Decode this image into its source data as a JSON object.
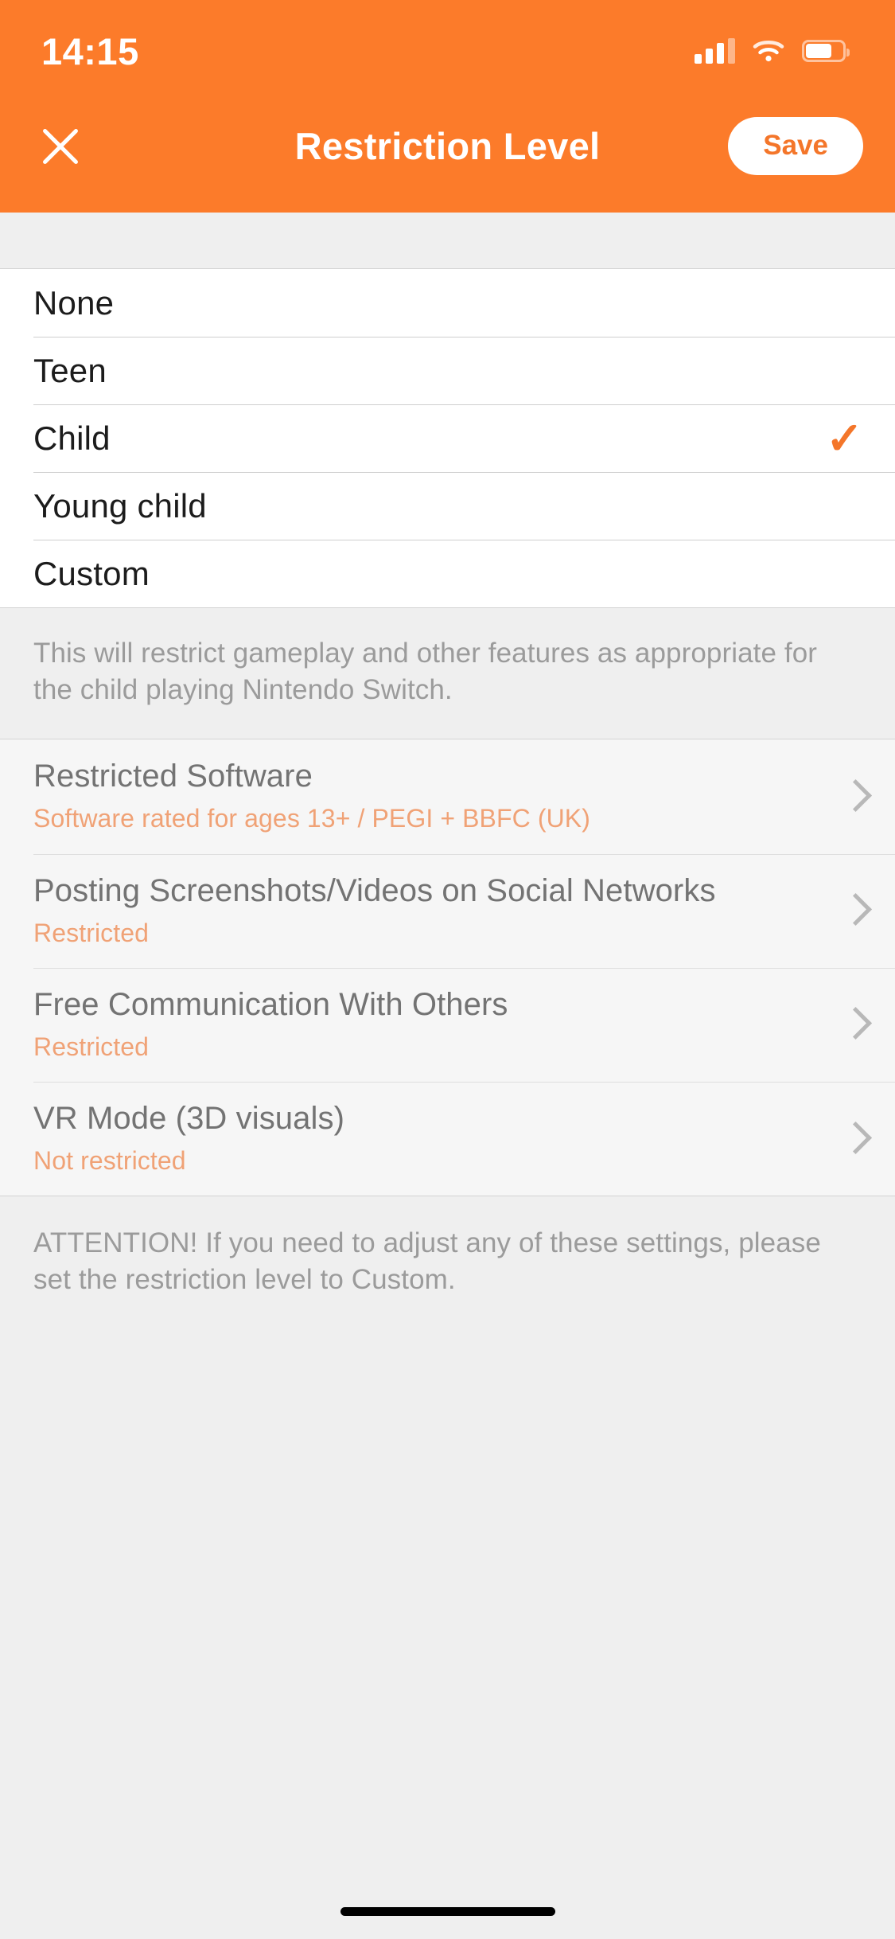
{
  "status_bar": {
    "time": "14:15",
    "signal_icon": "cellular-signal-icon",
    "wifi_icon": "wifi-icon",
    "battery_icon": "battery-icon"
  },
  "nav_bar": {
    "close_icon": "close-icon",
    "title": "Restriction Level",
    "save_label": "Save"
  },
  "colors": {
    "header_orange": "#FC7B2A",
    "accent_orange": "#F4762A",
    "subtitle_orange": "#F0A276",
    "gray_background": "#EFEFEF",
    "settings_background": "#F6F6F6"
  },
  "restriction_options": [
    {
      "label": "None",
      "selected": false,
      "check": ""
    },
    {
      "label": "Teen",
      "selected": false,
      "check": ""
    },
    {
      "label": "Child",
      "selected": true,
      "check": "✓"
    },
    {
      "label": "Young child",
      "selected": false,
      "check": ""
    },
    {
      "label": "Custom",
      "selected": false,
      "check": ""
    }
  ],
  "info_text": "This will restrict gameplay and other features as appropriate for the child playing Nintendo Switch.",
  "settings": [
    {
      "title": "Restricted Software",
      "subtitle": "Software rated for ages 13+ / PEGI + BBFC (UK)",
      "chevron": "chevron-right-icon"
    },
    {
      "title": "Posting Screenshots/Videos on Social Networks",
      "subtitle": "Restricted",
      "chevron": "chevron-right-icon"
    },
    {
      "title": "Free Communication With Others",
      "subtitle": "Restricted",
      "chevron": "chevron-right-icon"
    },
    {
      "title": "VR Mode (3D visuals)",
      "subtitle": "Not restricted",
      "chevron": "chevron-right-icon"
    }
  ],
  "attention_text": "ATTENTION! If you need to adjust any of these settings, please set the restriction level to Custom.",
  "home_indicator": "home-indicator-bar"
}
